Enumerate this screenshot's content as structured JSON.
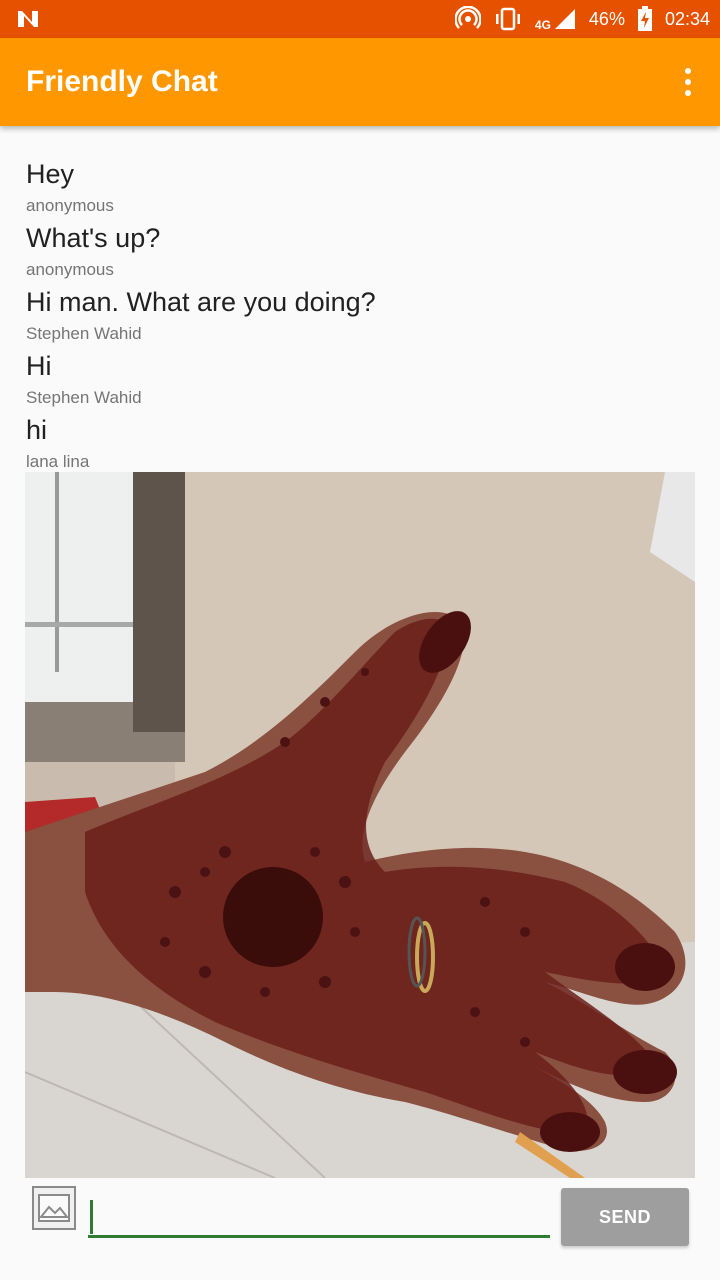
{
  "status_bar": {
    "notification_icon": "n-icon",
    "battery_percent": "46%",
    "time": "02:34",
    "network_label": "4G"
  },
  "app_bar": {
    "title": "Friendly Chat",
    "overflow_icon": "more-vert-icon"
  },
  "messages": [
    {
      "text": "Hey",
      "author": "anonymous"
    },
    {
      "text": "What's up?",
      "author": "anonymous"
    },
    {
      "text": "Hi man. What are you doing?",
      "author": "Stephen Wahid"
    },
    {
      "text": "Hi",
      "author": "Stephen Wahid"
    },
    {
      "text": "hi",
      "author": "lana lina"
    }
  ],
  "photo_message": {
    "icon": "photo-icon"
  },
  "composer": {
    "picker_icon": "image-icon",
    "input_value": "",
    "send_label": "SEND"
  },
  "colors": {
    "status_bar": "#e65100",
    "app_bar": "#ff9800",
    "input_underline": "#2e7d32",
    "send_button": "#9e9e9e"
  }
}
